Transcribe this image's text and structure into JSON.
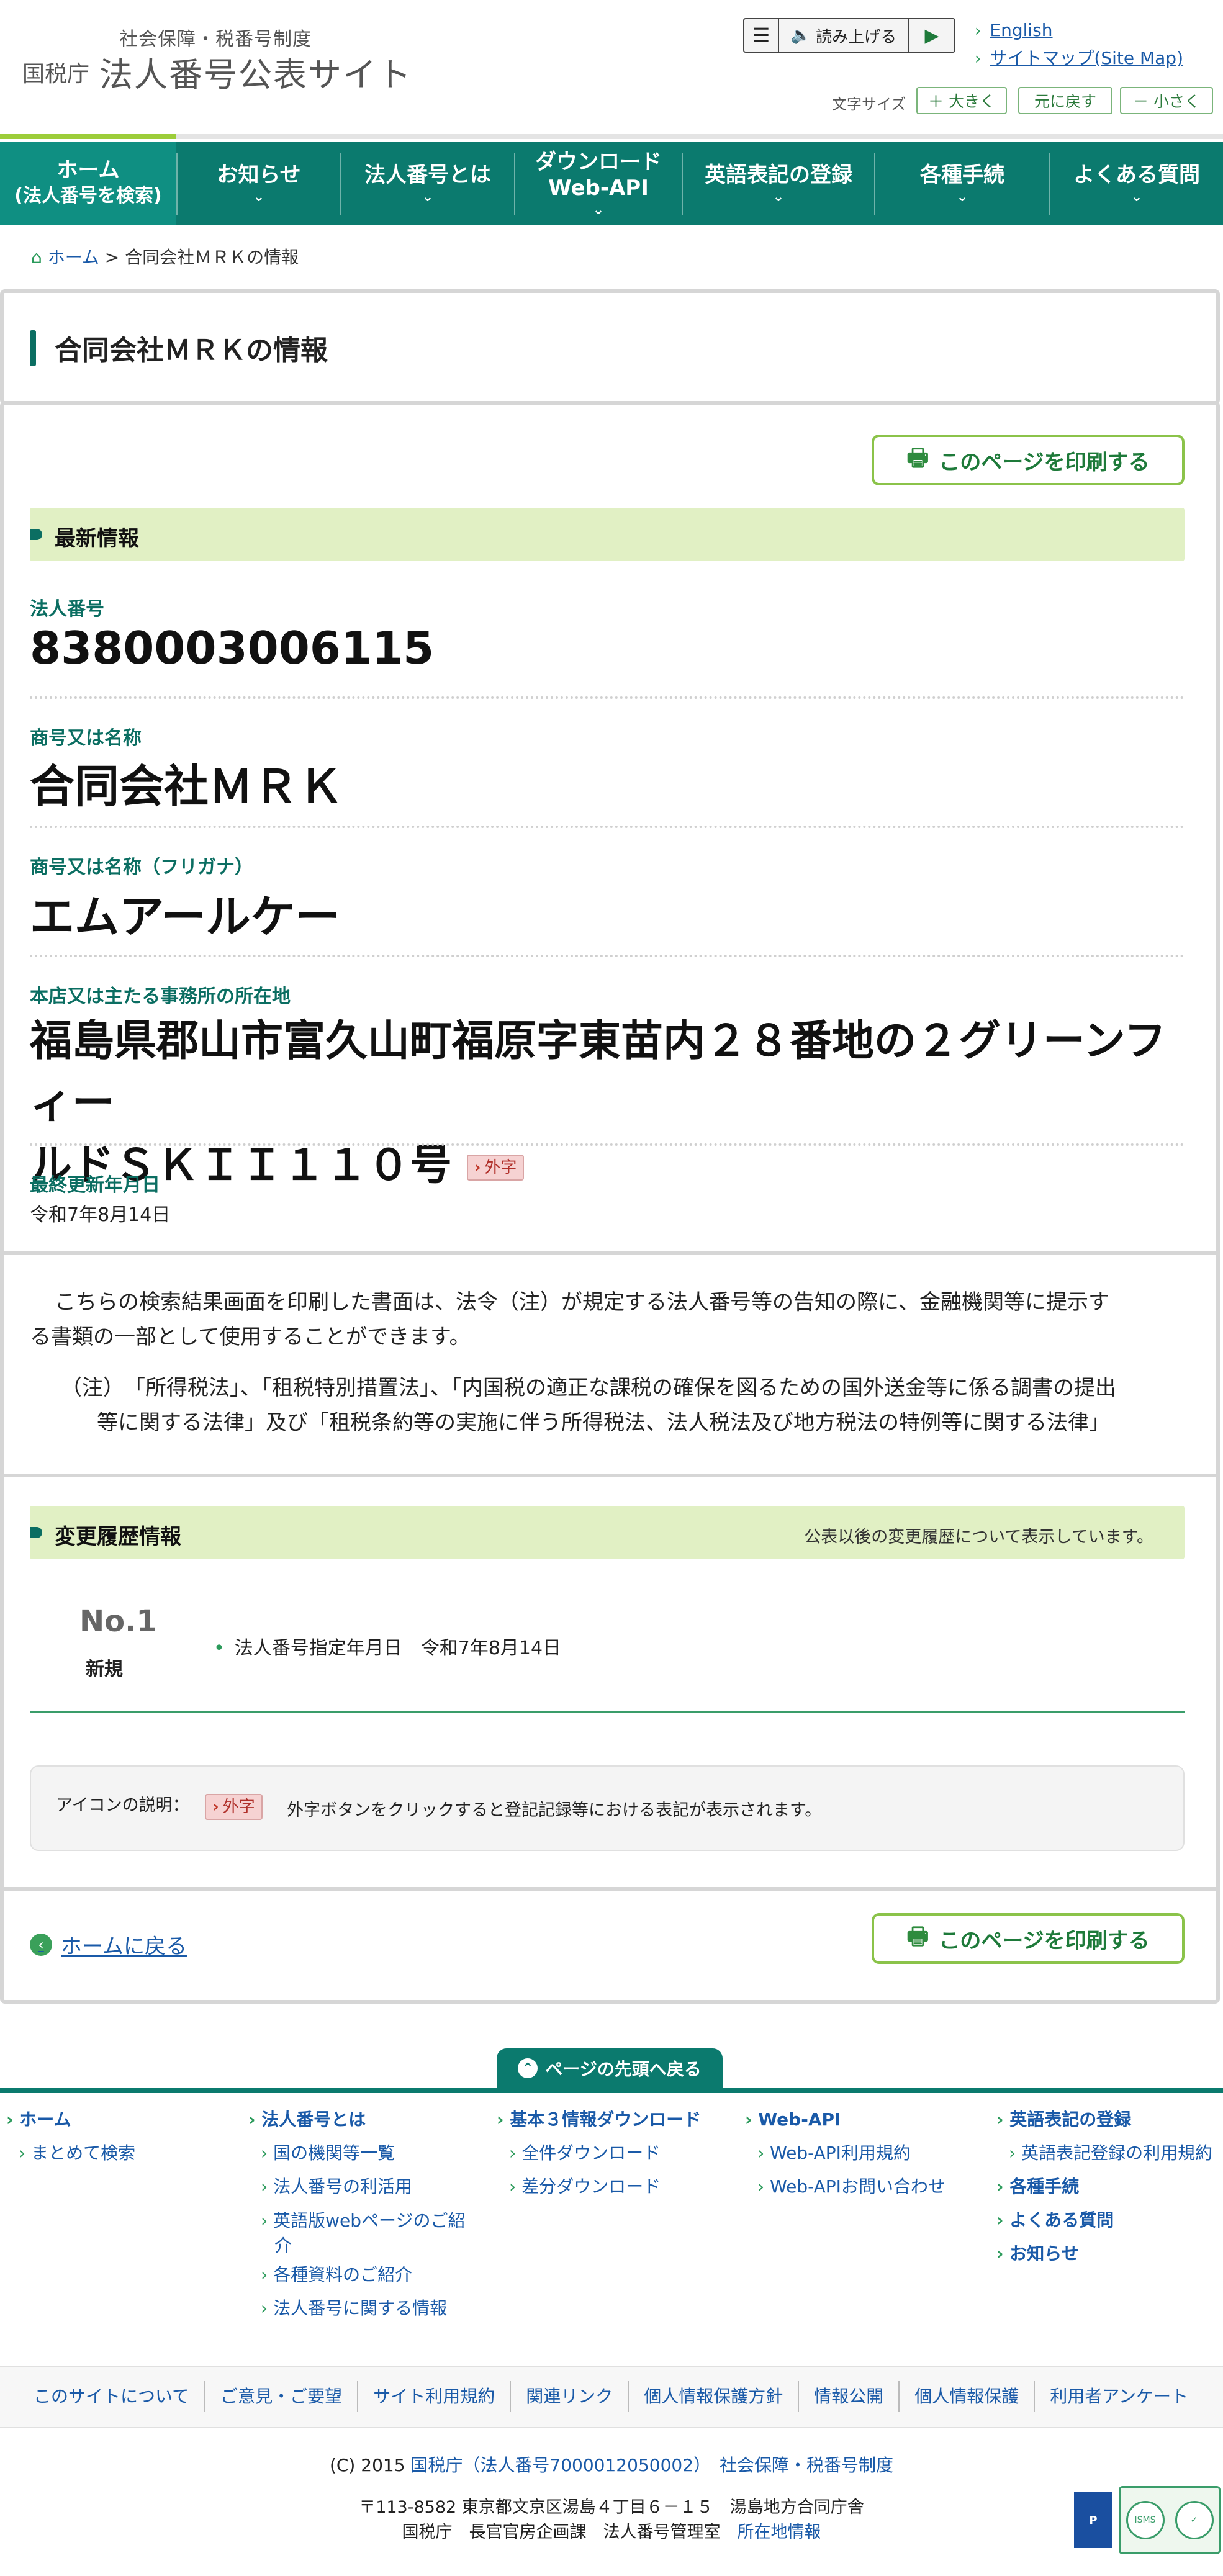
{
  "header": {
    "sub_title": "社会保障・税番号制度",
    "nta": "国税庁",
    "site_name": "法人番号公表サイト",
    "read_aloud": "読み上げる",
    "english": "English",
    "sitemap": "サイトマップ(Site Map)",
    "font_size_label": "文字サイズ",
    "font_larger": "＋ 大きく",
    "font_reset": "元に戻す",
    "font_smaller": "－ 小さく"
  },
  "nav": {
    "home_line1": "ホーム",
    "home_line2": "(法人番号を検索)",
    "news": "お知らせ",
    "about": "法人番号とは",
    "download_line1": "ダウンロード",
    "download_line2": "Web-API",
    "english_reg": "英語表記の登録",
    "procedures": "各種手続",
    "faq": "よくある質問"
  },
  "breadcrumb": {
    "home": "ホーム",
    "sep": ">",
    "current": "合同会社ＭＲＫの情報"
  },
  "page_title": "合同会社ＭＲＫの情報",
  "print_label": "このページを印刷する",
  "latest": {
    "heading": "最新情報",
    "corp_no_label": "法人番号",
    "corp_no": "8380003006115",
    "name_label": "商号又は名称",
    "name": "合同会社ＭＲＫ",
    "kana_label": "商号又は名称（フリガナ）",
    "kana": "エムアールケー",
    "address_label": "本店又は主たる事務所の所在地",
    "address_line1": "福島県郡山市富久山町福原字東苗内２８番地の２グリーンフィー",
    "address_line2": "ルドＳＫＩＩ１１０号",
    "gaiji": "外字",
    "updated_label": "最終更新年月日",
    "updated": "令和7年8月14日"
  },
  "notice": {
    "p1_line1": "こちらの検索結果画面を印刷した書面は、法令（注）が規定する法人番号等の告知の際に、金融機関等に提示す",
    "p1_line2": "る書類の一部として使用することができます。",
    "p2_line1": "（注）　「所得税法」、「租税特別措置法」、「内国税の適正な課税の確保を図るための国外送金等に係る調書の提出",
    "p2_line2": "等に関する法律」及び「租税条約等の実施に伴う所得税法、法人税法及び地方税法の特例等に関する法律」"
  },
  "history": {
    "heading": "変更履歴情報",
    "note": "公表以後の変更履歴について表示しています。",
    "no": "No.1",
    "type": "新規",
    "item": "法人番号指定年月日　令和7年8月14日"
  },
  "icon_legend": {
    "label": "アイコンの説明：",
    "gaiji": "外字",
    "text": "外字ボタンをクリックすると登記記録等における表記が表示されます。"
  },
  "back_home": "ホームに戻る",
  "to_top": "ページの先頭へ戻る",
  "footer": {
    "col1": {
      "head": "ホーム",
      "items": [
        "まとめて検索"
      ]
    },
    "col2": {
      "head": "法人番号とは",
      "items": [
        "国の機関等一覧",
        "法人番号の利活用",
        "英語版webページのご紹",
        "介",
        "各種資料のご紹介",
        "法人番号に関する情報"
      ]
    },
    "col3": {
      "head": "基本３情報ダウンロード",
      "items": [
        "全件ダウンロード",
        "差分ダウンロード"
      ]
    },
    "col4": {
      "head": "Web-API",
      "items": [
        "Web-API利用規約",
        "Web-APIお問い合わせ"
      ]
    },
    "col5": {
      "head": "英語表記の登録",
      "items": [
        "英語表記登録の利用規約"
      ],
      "extra": [
        "各種手続",
        "よくある質問",
        "お知らせ"
      ]
    },
    "links": [
      "このサイトについて",
      "ご意見・ご要望",
      "サイト利用規約",
      "関連リンク",
      "個人情報保護方針",
      "情報公開",
      "個人情報保護",
      "利用者アンケート"
    ],
    "copy_prefix": "(C) 2015 ",
    "copy_nta": "国税庁（法人番号7000012050002）",
    "copy_mynumber": "社会保障・税番号制度",
    "address": "〒113-8582 東京都文京区湯島４丁目６－１５　湯島地方合同庁舎",
    "dept": "国税庁　長官官房企画課　法人番号管理室",
    "location": "所在地情報",
    "logo_text": "ISMS"
  }
}
